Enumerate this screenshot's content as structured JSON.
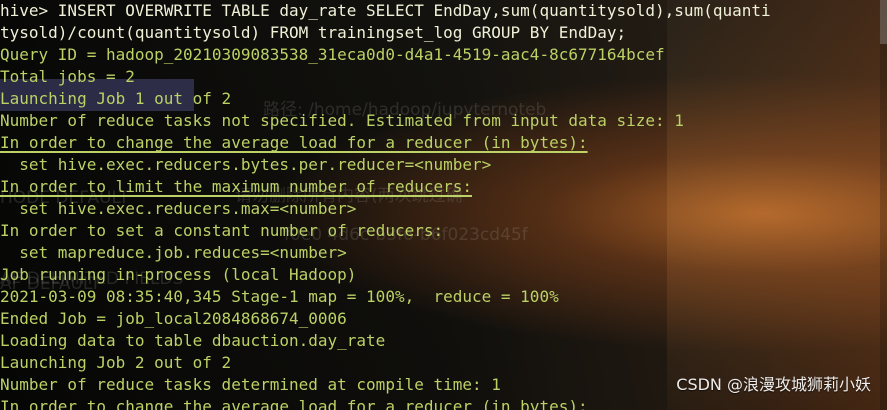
{
  "terminal": {
    "lines": [
      {
        "text": "hive> INSERT OVERWRITE TABLE day_rate SELECT EndDay,sum(quantitysold),sum(quanti",
        "kind": "prompt"
      },
      {
        "text": "tysold)/count(quantitysold) FROM trainingset_log GROUP BY EndDay;",
        "kind": "command"
      },
      {
        "text": "Query ID = hadoop_20210309083538_31eca0d0-d4a1-4519-aac4-8c677164bcef",
        "kind": "green"
      },
      {
        "text": "Total jobs = 2",
        "kind": "green"
      },
      {
        "text": "Launching Job 1 out of 2",
        "kind": "green"
      },
      {
        "text": "Number of reduce tasks not specified. Estimated from input data size: 1",
        "kind": "green"
      },
      {
        "text": "In order to change the average load for a reducer (in bytes):",
        "kind": "green"
      },
      {
        "text": "  set hive.exec.reducers.bytes.per.reducer=<number>",
        "kind": "green"
      },
      {
        "text": "In order to limit the maximum number of reducers:",
        "kind": "green"
      },
      {
        "text": "  set hive.exec.reducers.max=<number>",
        "kind": "green"
      },
      {
        "text": "In order to set a constant number of reducers:",
        "kind": "green"
      },
      {
        "text": "  set mapreduce.job.reduces=<number>",
        "kind": "green"
      },
      {
        "text": "Job running in-process (local Hadoop)",
        "kind": "green"
      },
      {
        "text": "2021-03-09 08:35:40,345 Stage-1 map = 100%,  reduce = 100%",
        "kind": "green"
      },
      {
        "text": "Ended Job = job_local2084868674_0006",
        "kind": "green"
      },
      {
        "text": "Loading data to table dbauction.day_rate",
        "kind": "green"
      },
      {
        "text": "Launching Job 2 out of 2",
        "kind": "green"
      },
      {
        "text": "Number of reduce tasks determined at compile time: 1",
        "kind": "green"
      },
      {
        "text": "In order to change the average load for a reducer (in bytes):",
        "kind": "green"
      }
    ]
  },
  "watermark": "CSDN @浪漫攻城狮莉小妖",
  "ghost_text": [
    "HODE DEFAULT",
    "AF DEFAULT",
    "路径: /home/hadoop/jupyternoteb",
    "请勿删除所有内容(两次跳过确",
    "f0e0 4d6c-b3f6-b6f023cd45f",
    "AF DELIMITED FIELDS"
  ]
}
